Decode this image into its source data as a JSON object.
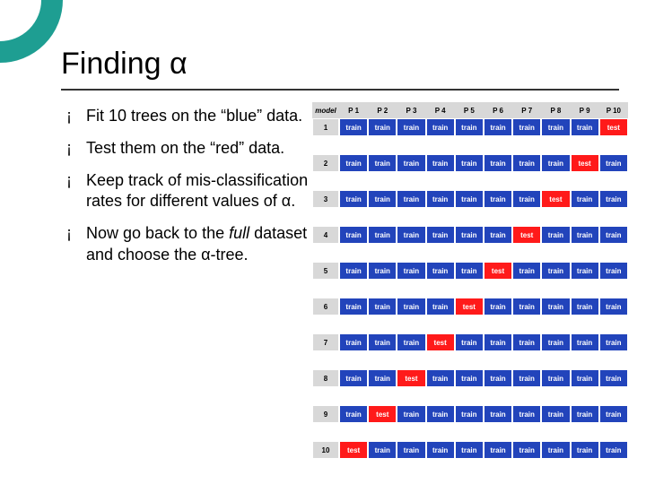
{
  "title": "Finding α",
  "bullets": [
    {
      "pre": "Fit 10 trees on the “blue” data.",
      "ital": "",
      "post": ""
    },
    {
      "pre": "Test them on the “red” data.",
      "ital": "",
      "post": ""
    },
    {
      "pre": "Keep track of mis-classification rates for different values of α.",
      "ital": "",
      "post": ""
    },
    {
      "pre": "Now go back to the ",
      "ital": "full",
      "post": " dataset and choose the α-tree."
    }
  ],
  "table": {
    "corner": "model",
    "columns": [
      "P 1",
      "P 2",
      "P 3",
      "P 4",
      "P 5",
      "P 6",
      "P 7",
      "P 8",
      "P 9",
      "P 10"
    ],
    "rows": [
      {
        "label": "1",
        "test_col": 10
      },
      {
        "label": "2",
        "test_col": 9
      },
      {
        "label": "3",
        "test_col": 8
      },
      {
        "label": "4",
        "test_col": 7
      },
      {
        "label": "5",
        "test_col": 6
      },
      {
        "label": "6",
        "test_col": 5
      },
      {
        "label": "7",
        "test_col": 4
      },
      {
        "label": "8",
        "test_col": 3
      },
      {
        "label": "9",
        "test_col": 2
      },
      {
        "label": "10",
        "test_col": 1
      }
    ],
    "train_label": "train",
    "test_label": "test"
  }
}
